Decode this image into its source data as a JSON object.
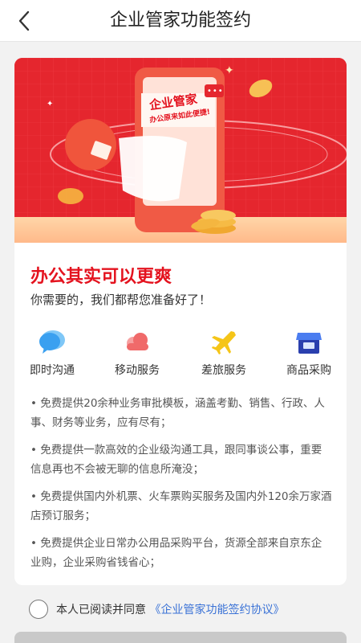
{
  "nav": {
    "title": "企业管家功能签约",
    "back_icon": "chevron-left-icon"
  },
  "banner": {
    "screen_title": "企业管家",
    "screen_subtitle": "办公原来如此便捷!",
    "colors": {
      "background": "#e5262e",
      "phone": "#f05a45",
      "coin": "#f5b640"
    }
  },
  "intro": {
    "headline": "办公其实可以更爽",
    "subheadline": "你需要的，我们都帮您准备好了！"
  },
  "features": [
    {
      "label": "即时沟通",
      "icon": "chat-bubble-icon",
      "color": "#3aa0f0"
    },
    {
      "label": "移动服务",
      "icon": "cloud-icon",
      "color": "#f06a6a"
    },
    {
      "label": "差旅服务",
      "icon": "airplane-icon",
      "color": "#f5c518"
    },
    {
      "label": "商品采购",
      "icon": "store-icon",
      "color": "#3f6fe0"
    }
  ],
  "bullets": [
    "• 免费提供20余种业务审批模板，涵盖考勤、销售、行政、人事、财务等业务，应有尽有；",
    "• 免费提供一款高效的企业级沟通工具，跟同事谈公事，重要信息再也不会被无聊的信息所淹没；",
    "• 免费提供国内外机票、火车票购买服务及国内外120余万家酒店预订服务；",
    "• 免费提供企业日常办公用品采购平台，货源全部来自京东企业购，企业采购省钱省心；"
  ],
  "agreement": {
    "prefix": "本人已阅读并同意",
    "link": "《企业管家功能签约协议》"
  },
  "colors": {
    "accent": "#e4131f",
    "link": "#3a72d6",
    "button_disabled": "#c9c9c9"
  }
}
